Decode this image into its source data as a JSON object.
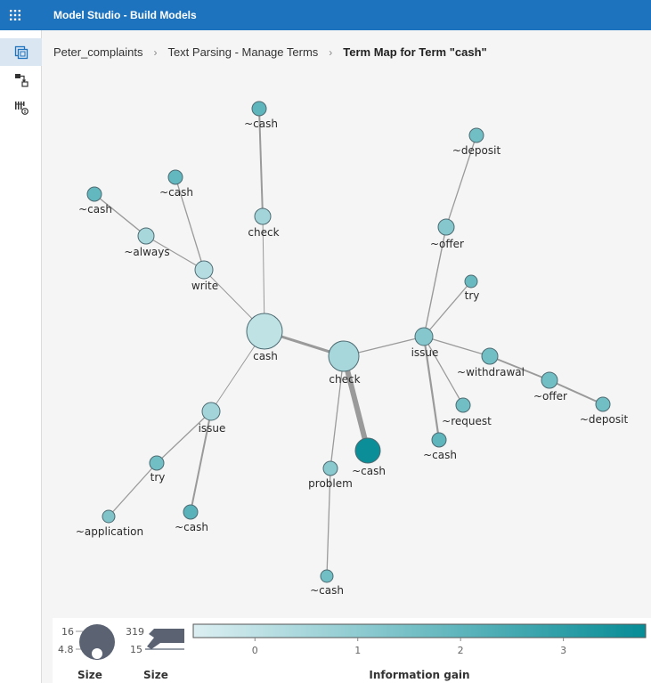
{
  "header": {
    "title": "Model Studio - Build Models",
    "apps_icon": "apps-grid-icon"
  },
  "sidebar": {
    "items": [
      {
        "name": "data-view",
        "icon": "data-copy-icon",
        "active": true
      },
      {
        "name": "pipeline-view",
        "icon": "pipeline-flow-icon",
        "active": false
      },
      {
        "name": "results-view",
        "icon": "results-table-icon",
        "active": false
      }
    ]
  },
  "breadcrumb": {
    "items": [
      "Peter_complaints",
      "Text Parsing - Manage Terms"
    ],
    "current": "Term Map for Term \"cash\""
  },
  "term_map": {
    "nodes": [
      {
        "id": "root",
        "label": "cash",
        "gain": 0.0
      },
      {
        "id": "check1",
        "label": "check",
        "gain": 0.6
      },
      {
        "id": "cash_top",
        "label": "~cash",
        "gain": 2.0
      },
      {
        "id": "write",
        "label": "write",
        "gain": 0.2
      },
      {
        "id": "cash_w",
        "label": "~cash",
        "gain": 1.9
      },
      {
        "id": "always",
        "label": "~always",
        "gain": 0.5
      },
      {
        "id": "cash_a",
        "label": "~cash",
        "gain": 1.9
      },
      {
        "id": "issue1",
        "label": "issue",
        "gain": 0.6
      },
      {
        "id": "try1",
        "label": "try",
        "gain": 1.6
      },
      {
        "id": "application",
        "label": "~application",
        "gain": 1.3
      },
      {
        "id": "cash_i",
        "label": "~cash",
        "gain": 2.1
      },
      {
        "id": "check2",
        "label": "check",
        "gain": 0.5
      },
      {
        "id": "cash_main",
        "label": "~cash",
        "gain": 3.7
      },
      {
        "id": "problem",
        "label": "problem",
        "gain": 1.1
      },
      {
        "id": "cash_p",
        "label": "~cash",
        "gain": 1.6
      },
      {
        "id": "issue2",
        "label": "issue",
        "gain": 1.2
      },
      {
        "id": "offer1",
        "label": "~offer",
        "gain": 1.2
      },
      {
        "id": "deposit1",
        "label": "~deposit",
        "gain": 1.6
      },
      {
        "id": "try2",
        "label": "try",
        "gain": 1.8
      },
      {
        "id": "withdrawal",
        "label": "~withdrawal",
        "gain": 1.6
      },
      {
        "id": "offer2",
        "label": "~offer",
        "gain": 1.6
      },
      {
        "id": "deposit2",
        "label": "~deposit",
        "gain": 1.6
      },
      {
        "id": "request",
        "label": "~request",
        "gain": 1.6
      },
      {
        "id": "cash_r",
        "label": "~cash",
        "gain": 2.0
      }
    ],
    "links": [
      {
        "from": "root",
        "to": "check1",
        "weight": 1
      },
      {
        "from": "check1",
        "to": "cash_top",
        "weight": 2
      },
      {
        "from": "root",
        "to": "write",
        "weight": 1
      },
      {
        "from": "write",
        "to": "cash_w",
        "weight": 1.3
      },
      {
        "from": "write",
        "to": "always",
        "weight": 1.2
      },
      {
        "from": "always",
        "to": "cash_a",
        "weight": 1.4
      },
      {
        "from": "root",
        "to": "issue1",
        "weight": 1
      },
      {
        "from": "issue1",
        "to": "try1",
        "weight": 1.3
      },
      {
        "from": "try1",
        "to": "application",
        "weight": 1.3
      },
      {
        "from": "issue1",
        "to": "cash_i",
        "weight": 2
      },
      {
        "from": "root",
        "to": "check2",
        "weight": 3
      },
      {
        "from": "check2",
        "to": "cash_main",
        "weight": 6
      },
      {
        "from": "check2",
        "to": "problem",
        "weight": 1.3
      },
      {
        "from": "problem",
        "to": "cash_p",
        "weight": 1.3
      },
      {
        "from": "check2",
        "to": "issue2",
        "weight": 1.3
      },
      {
        "from": "issue2",
        "to": "offer1",
        "weight": 1.4
      },
      {
        "from": "offer1",
        "to": "deposit1",
        "weight": 1.3
      },
      {
        "from": "issue2",
        "to": "try2",
        "weight": 1.3
      },
      {
        "from": "issue2",
        "to": "withdrawal",
        "weight": 1.3
      },
      {
        "from": "withdrawal",
        "to": "offer2",
        "weight": 2
      },
      {
        "from": "offer2",
        "to": "deposit2",
        "weight": 2
      },
      {
        "from": "issue2",
        "to": "request",
        "weight": 1.3
      },
      {
        "from": "issue2",
        "to": "cash_r",
        "weight": 2.2
      }
    ]
  },
  "legend": {
    "node_size": {
      "label": "Size",
      "max": "16",
      "min": "4.8"
    },
    "link_size": {
      "label": "Size",
      "max": "319",
      "min": "15"
    },
    "color_scale": {
      "label": "Information gain",
      "ticks": [
        "0",
        "1",
        "2",
        "3"
      ],
      "min": -0.6,
      "max": 3.8,
      "color_low": "#dceff2",
      "color_high": "#078c96"
    }
  }
}
